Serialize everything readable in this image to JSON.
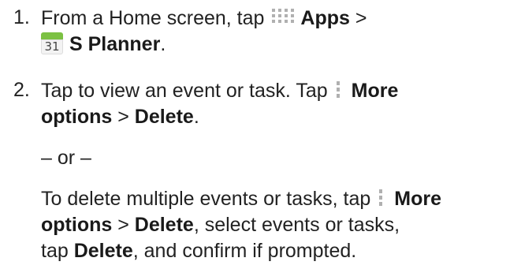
{
  "steps": [
    {
      "number": "1.",
      "line1": {
        "prefix": "From a Home screen, tap",
        "apps_label": "Apps",
        "separator": ">"
      },
      "line2": {
        "calendar_day": "31",
        "planner_label": "S Planner",
        "end": "."
      }
    },
    {
      "number": "2.",
      "line1": {
        "prefix": "Tap to view an event or task. Tap",
        "more_label": "More"
      },
      "line2": {
        "options_label": "options",
        "separator": ">",
        "delete_label": "Delete",
        "end": "."
      },
      "or_text": "– or –",
      "alt": {
        "line1_prefix": "To delete multiple events or tasks, tap",
        "line1_more": "More",
        "line2_options": "options",
        "line2_sep": ">",
        "line2_delete": "Delete",
        "line2_rest": ", select events or tasks,",
        "line3_prefix": "tap",
        "line3_delete": "Delete",
        "line3_rest": ", and confirm if prompted."
      }
    }
  ],
  "icons": {
    "apps": "apps-grid-icon",
    "calendar": "calendar-icon",
    "more": "more-options-icon"
  },
  "colors": {
    "text": "#222222",
    "calendar_green": "#7cc143",
    "icon_gray": "#b0b0b0"
  }
}
